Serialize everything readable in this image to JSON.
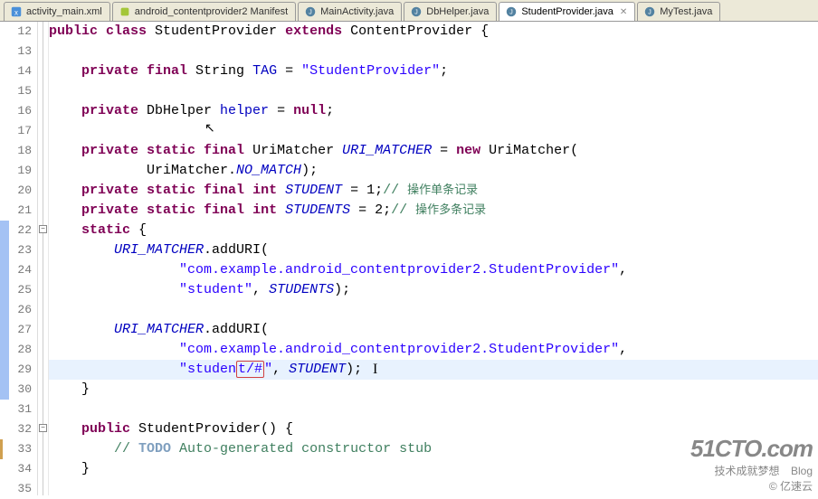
{
  "tabs": [
    {
      "label": "activity_main.xml",
      "icon": "xml"
    },
    {
      "label": "android_contentprovider2 Manifest",
      "icon": "android"
    },
    {
      "label": "MainActivity.java",
      "icon": "java"
    },
    {
      "label": "DbHelper.java",
      "icon": "java"
    },
    {
      "label": "StudentProvider.java",
      "icon": "java",
      "active": true
    },
    {
      "label": "MyTest.java",
      "icon": "java"
    }
  ],
  "line_numbers": [
    12,
    13,
    14,
    15,
    16,
    17,
    18,
    19,
    20,
    21,
    22,
    23,
    24,
    25,
    26,
    27,
    28,
    29,
    30,
    31,
    32,
    33,
    34,
    35
  ],
  "code": {
    "l12": {
      "t1": "public",
      "t2": " class",
      "t3": " StudentProvider ",
      "t4": "extends",
      "t5": " ContentProvider {"
    },
    "l14": {
      "t1": "    private",
      "t2": " final",
      "t3": " String ",
      "t4": "TAG",
      "t5": " = ",
      "t6": "\"StudentProvider\"",
      "t7": ";"
    },
    "l16": {
      "t1": "    private",
      "t2": " DbHelper ",
      "t3": "helper",
      "t4": " = ",
      "t5": "null",
      "t6": ";"
    },
    "l18": {
      "t1": "    private",
      "t2": " static",
      "t3": " final",
      "t4": " UriMatcher ",
      "t5": "URI_MATCHER",
      "t6": " = ",
      "t7": "new",
      "t8": " UriMatcher("
    },
    "l19": {
      "t1": "            UriMatcher.",
      "t2": "NO_MATCH",
      "t3": ");"
    },
    "l20": {
      "t1": "    private",
      "t2": " static",
      "t3": " final",
      "t4": " int",
      "t5": " ",
      "t6": "STUDENT",
      "t7": " = 1;",
      "t8": "// ",
      "t9": "操作单条记录"
    },
    "l21": {
      "t1": "    private",
      "t2": " static",
      "t3": " final",
      "t4": " int",
      "t5": " ",
      "t6": "STUDENTS",
      "t7": " = 2;",
      "t8": "// ",
      "t9": "操作多条记录"
    },
    "l22": {
      "t1": "    static",
      "t2": " {"
    },
    "l23": {
      "t1": "        ",
      "t2": "URI_MATCHER",
      "t3": ".addURI("
    },
    "l24": {
      "t1": "                ",
      "t2": "\"com.example.android_contentprovider2.StudentProvider\"",
      "t3": ","
    },
    "l25": {
      "t1": "                ",
      "t2": "\"student\"",
      "t3": ", ",
      "t4": "STUDENTS",
      "t5": ");"
    },
    "l27": {
      "t1": "        ",
      "t2": "URI_MATCHER",
      "t3": ".addURI("
    },
    "l28": {
      "t1": "                ",
      "t2": "\"com.example.android_contentprovider2.StudentProvider\"",
      "t3": ","
    },
    "l29": {
      "t1": "                ",
      "t2": "\"studen",
      "t3": "t/#",
      "t4": "\"",
      "t5": ", ",
      "t6": "STUDENT",
      "t7": ");"
    },
    "l30": {
      "t1": "    }"
    },
    "l32": {
      "t1": "    public",
      "t2": " StudentProvider() {"
    },
    "l33": {
      "t1": "        ",
      "t2": "// ",
      "t3": "TODO",
      "t4": " Auto-generated constructor stub"
    },
    "l34": {
      "t1": "    }"
    }
  },
  "watermark": {
    "big": "51CTO.com",
    "small1": "技术成就梦想",
    "small2": "Blog",
    "small3": "© 亿速云"
  }
}
